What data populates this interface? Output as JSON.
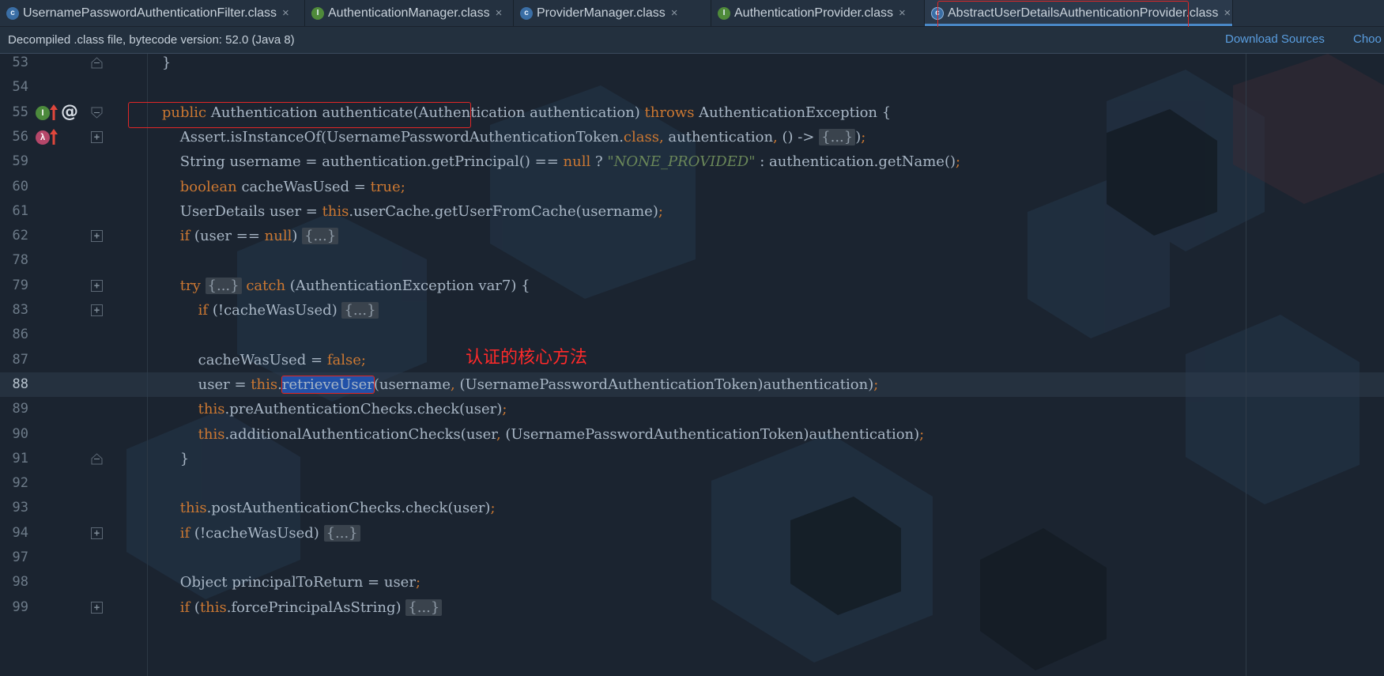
{
  "tabs": [
    {
      "icon": "class-icon",
      "letter": "c",
      "label": "UsernamePasswordAuthenticationFilter.class",
      "active": false
    },
    {
      "icon": "interface-icon",
      "letter": "I",
      "label": "AuthenticationManager.class",
      "active": false
    },
    {
      "icon": "class-icon",
      "letter": "c",
      "label": "ProviderManager.class",
      "active": false
    },
    {
      "icon": "interface-icon",
      "letter": "I",
      "label": "AuthenticationProvider.class",
      "active": false
    },
    {
      "icon": "abstract-class-icon",
      "letter": "c",
      "label": "AbstractUserDetailsAuthenticationProvider.class",
      "active": true
    }
  ],
  "tab_close_glyph": "×",
  "infobar": {
    "message": "Decompiled .class file, bytecode version: 52.0 (Java 8)",
    "download_sources": "Download Sources",
    "choose_sources": "Choo"
  },
  "gutter": {
    "implements_icon": "I",
    "lambda_icon": "λ",
    "annotation_marker": "@"
  },
  "annotation_text": "认证的核心方法",
  "code_lines": [
    {
      "n": "53",
      "t": "    }"
    },
    {
      "n": "54",
      "t": ""
    },
    {
      "n": "55",
      "t": "    public Authentication authenticate(Authentication authentication) throws AuthenticationException {"
    },
    {
      "n": "56",
      "t": "        Assert.isInstanceOf(UsernamePasswordAuthenticationToken.class, authentication, () -> {...});"
    },
    {
      "n": "59",
      "t": "        String username = authentication.getPrincipal() == null ? \"NONE_PROVIDED\" : authentication.getName();"
    },
    {
      "n": "60",
      "t": "        boolean cacheWasUsed = true;"
    },
    {
      "n": "61",
      "t": "        UserDetails user = this.userCache.getUserFromCache(username);"
    },
    {
      "n": "62",
      "t": "        if (user == null) {...}"
    },
    {
      "n": "78",
      "t": ""
    },
    {
      "n": "79",
      "t": "        try {...} catch (AuthenticationException var7) {"
    },
    {
      "n": "83",
      "t": "            if (!cacheWasUsed) {...}"
    },
    {
      "n": "86",
      "t": ""
    },
    {
      "n": "87",
      "t": "            cacheWasUsed = false;"
    },
    {
      "n": "88",
      "t": "            user = this.retrieveUser(username, (UsernamePasswordAuthenticationToken)authentication);"
    },
    {
      "n": "89",
      "t": "            this.preAuthenticationChecks.check(user);"
    },
    {
      "n": "90",
      "t": "            this.additionalAuthenticationChecks(user, (UsernamePasswordAuthenticationToken)authentication);"
    },
    {
      "n": "91",
      "t": "        }"
    },
    {
      "n": "92",
      "t": ""
    },
    {
      "n": "93",
      "t": "        this.postAuthenticationChecks.check(user);"
    },
    {
      "n": "94",
      "t": "        if (!cacheWasUsed) {...}"
    },
    {
      "n": "97",
      "t": ""
    },
    {
      "n": "98",
      "t": "        Object principalToReturn = user;"
    },
    {
      "n": "99",
      "t": "        if (this.forcePrincipalAsString) {...}"
    }
  ],
  "colors": {
    "background": "#1b2430",
    "keyword": "#cc7832",
    "string": "#6a8759",
    "text": "#a9b7c6",
    "link": "#5a9ee0",
    "highlight_box": "#e02727",
    "annotation": "#ff2a2a",
    "selection": "#2151a8"
  }
}
